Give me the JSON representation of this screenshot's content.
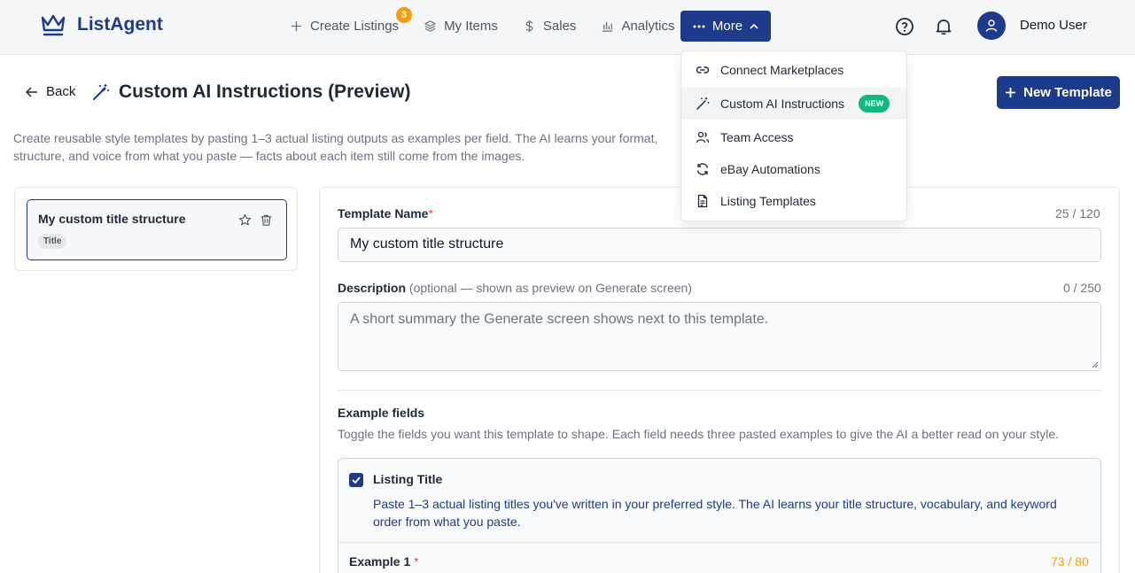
{
  "app": {
    "name": "ListAgent"
  },
  "nav": {
    "items": [
      {
        "label": "Create Listings",
        "icon": "plus-icon",
        "badge": "3"
      },
      {
        "label": "My Items",
        "icon": "layers-icon"
      },
      {
        "label": "Sales",
        "icon": "dollar-icon"
      },
      {
        "label": "Analytics",
        "icon": "bar-chart-icon"
      }
    ],
    "more_label": "More"
  },
  "user": {
    "name": "Demo User"
  },
  "page": {
    "back_label": "Back",
    "title": "Custom AI Instructions (Preview)",
    "new_template_label": "New Template",
    "intro": "Create reusable style templates by pasting 1–3 actual listing outputs as examples per field. The AI learns your format, structure, and voice from what you paste — facts about each item still come from the images."
  },
  "templates": [
    {
      "name": "My custom title structure",
      "tag": "Title"
    }
  ],
  "form": {
    "name_label": "Template Name",
    "name_counter": "25 / 120",
    "name_value": "My custom title structure",
    "desc_label": "Description",
    "desc_hint": "(optional — shown as preview on Generate screen)",
    "desc_counter": "0 / 250",
    "desc_placeholder": "A short summary the Generate screen shows next to this template.",
    "section_title": "Example fields",
    "section_desc": "Toggle the fields you want this template to shape. Each field needs three pasted examples to give the AI a better read on your style.",
    "field": {
      "title": "Listing Title",
      "checked": true,
      "desc": "Paste 1–3 actual listing titles you've written in your preferred style. The AI learns your title structure, vocabulary, and keyword order from what you paste.",
      "example_label": "Example 1",
      "example_counter": "73 / 80"
    }
  },
  "more_menu": [
    {
      "label": "Connect Marketplaces",
      "icon": "link-icon"
    },
    {
      "label": "Custom AI Instructions",
      "icon": "magic-wand-icon",
      "badge": "NEW",
      "active": true
    },
    {
      "label": "Team Access",
      "icon": "users-icon"
    },
    {
      "label": "eBay Automations",
      "icon": "refresh-icon"
    },
    {
      "label": "Listing Templates",
      "icon": "document-icon"
    }
  ],
  "colors": {
    "primary": "#1e3a8a",
    "badge_orange": "#f59e0b",
    "new_green": "#10b981"
  }
}
